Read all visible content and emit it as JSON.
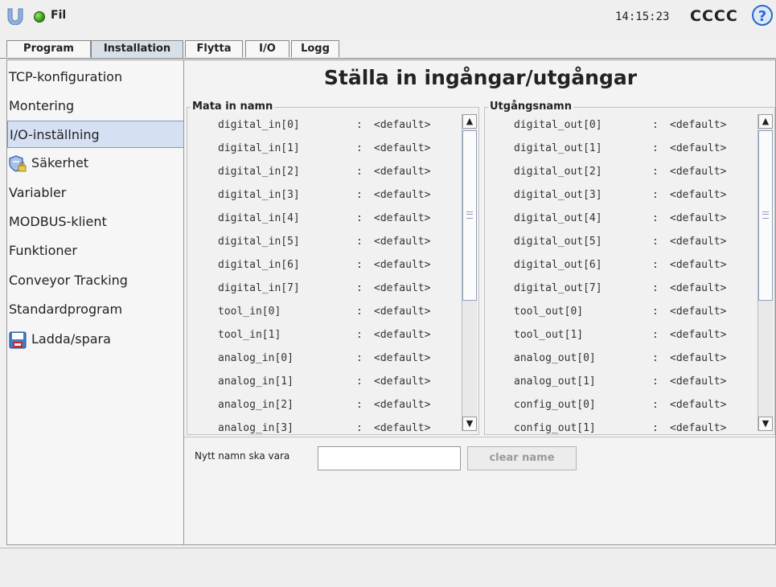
{
  "header": {
    "file_menu": "Fil",
    "time": "14:15:23",
    "robot_name": "CCCC",
    "help_symbol": "?"
  },
  "tabs": [
    {
      "label": "Program"
    },
    {
      "label": "Installation",
      "active": true
    },
    {
      "label": "Flytta"
    },
    {
      "label": "I/O"
    },
    {
      "label": "Logg"
    }
  ],
  "sidebar": {
    "items": [
      {
        "label": "TCP-konfiguration"
      },
      {
        "label": "Montering"
      },
      {
        "label": "I/O-inställning",
        "selected": true
      },
      {
        "label": "Säkerhet",
        "icon": "shield-lock-icon"
      },
      {
        "label": "Variabler"
      },
      {
        "label": "MODBUS-klient"
      },
      {
        "label": "Funktioner"
      },
      {
        "label": "Conveyor Tracking"
      },
      {
        "label": "Standardprogram"
      },
      {
        "label": "Ladda/spara",
        "icon": "floppy-disk-icon"
      }
    ]
  },
  "main": {
    "title": "Ställa in ingångar/utgångar",
    "inputs": {
      "label": "Mata in namn",
      "rows": [
        {
          "name": "digital_in[0]",
          "colon": ":",
          "value": "<default>"
        },
        {
          "name": "digital_in[1]",
          "colon": ":",
          "value": "<default>"
        },
        {
          "name": "digital_in[2]",
          "colon": ":",
          "value": "<default>"
        },
        {
          "name": "digital_in[3]",
          "colon": ":",
          "value": "<default>"
        },
        {
          "name": "digital_in[4]",
          "colon": ":",
          "value": "<default>"
        },
        {
          "name": "digital_in[5]",
          "colon": ":",
          "value": "<default>"
        },
        {
          "name": "digital_in[6]",
          "colon": ":",
          "value": "<default>"
        },
        {
          "name": "digital_in[7]",
          "colon": ":",
          "value": "<default>"
        },
        {
          "name": "tool_in[0]",
          "colon": ":",
          "value": "<default>"
        },
        {
          "name": "tool_in[1]",
          "colon": ":",
          "value": "<default>"
        },
        {
          "name": "analog_in[0]",
          "colon": ":",
          "value": "<default>"
        },
        {
          "name": "analog_in[1]",
          "colon": ":",
          "value": "<default>"
        },
        {
          "name": "analog_in[2]",
          "colon": ":",
          "value": "<default>"
        },
        {
          "name": "analog_in[3]",
          "colon": ":",
          "value": "<default>"
        }
      ]
    },
    "outputs": {
      "label": "Utgångsnamn",
      "rows": [
        {
          "name": "digital_out[0]",
          "colon": ":",
          "value": "<default>"
        },
        {
          "name": "digital_out[1]",
          "colon": ":",
          "value": "<default>"
        },
        {
          "name": "digital_out[2]",
          "colon": ":",
          "value": "<default>"
        },
        {
          "name": "digital_out[3]",
          "colon": ":",
          "value": "<default>"
        },
        {
          "name": "digital_out[4]",
          "colon": ":",
          "value": "<default>"
        },
        {
          "name": "digital_out[5]",
          "colon": ":",
          "value": "<default>"
        },
        {
          "name": "digital_out[6]",
          "colon": ":",
          "value": "<default>"
        },
        {
          "name": "digital_out[7]",
          "colon": ":",
          "value": "<default>"
        },
        {
          "name": "tool_out[0]",
          "colon": ":",
          "value": "<default>"
        },
        {
          "name": "tool_out[1]",
          "colon": ":",
          "value": "<default>"
        },
        {
          "name": "analog_out[0]",
          "colon": ":",
          "value": "<default>"
        },
        {
          "name": "analog_out[1]",
          "colon": ":",
          "value": "<default>"
        },
        {
          "name": "config_out[0]",
          "colon": ":",
          "value": "<default>"
        },
        {
          "name": "config_out[1]",
          "colon": ":",
          "value": "<default>"
        }
      ]
    },
    "new_name_label": "Nytt namn ska vara",
    "new_name_value": "",
    "clear_button": "clear name"
  }
}
